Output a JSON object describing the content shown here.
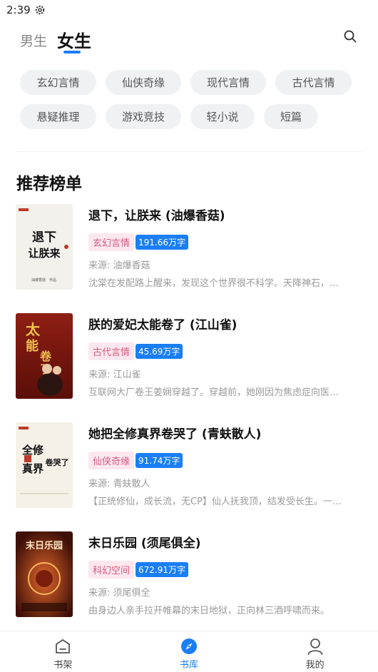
{
  "status": {
    "time": "2:39",
    "gear_icon": "gear-icon"
  },
  "header": {
    "tabs": [
      {
        "label": "男生",
        "active": false
      },
      {
        "label": "女生",
        "active": true
      }
    ],
    "search_icon": "search-icon"
  },
  "categories": [
    "玄幻言情",
    "仙侠奇缘",
    "现代言情",
    "古代言情",
    "悬疑推理",
    "游戏竞技",
    "轻小说",
    "短篇"
  ],
  "section": {
    "title": "推荐榜单"
  },
  "books": [
    {
      "title": "退下，让朕来 (油爆香菇)",
      "genre": "玄幻言情",
      "words": "191.66万字",
      "source": "来源: 油爆香菇",
      "intro": "沈棠在发配路上醒来，发现这个世界很不科学。天降神石，…",
      "cover_text": [
        "退下",
        "让朕来",
        "油爆香菇",
        "作品"
      ]
    },
    {
      "title": "朕的爱妃太能卷了 (江山雀)",
      "genre": "古代言情",
      "words": "45.69万字",
      "source": "来源: 江山雀",
      "intro": "互联网大厂卷王姜娴穿越了。穿越前，她刚因为焦虑症向医…",
      "cover_text": [
        "太",
        "能",
        "卷",
        "了"
      ]
    },
    {
      "title": "她把全修真界卷哭了 (青蚨散人)",
      "genre": "仙侠奇缘",
      "words": "91.74万字",
      "source": "来源: 青蚨散人",
      "intro": "【正统修仙，成长流，无CP】仙人抚我顶，结发受长生。一…",
      "cover_text": [
        "全修",
        "真界",
        "卷哭了"
      ]
    },
    {
      "title": "末日乐园 (须尾俱全)",
      "genre": "科幻空间",
      "words": "672.91万字",
      "source": "来源: 须尾俱全",
      "intro": "由身边人亲手拉开帷幕的末日地狱，正向林三酒呼啸而来。",
      "cover_text": [
        "末日乐园"
      ]
    }
  ],
  "bottom_nav": [
    {
      "label": "书架",
      "icon": "bookshelf-icon",
      "active": false
    },
    {
      "label": "书库",
      "icon": "compass-icon",
      "active": true
    },
    {
      "label": "我的",
      "icon": "profile-icon",
      "active": false
    }
  ],
  "colors": {
    "accent": "#1a7ef5",
    "tag_bg": "#fde7ee",
    "tag_text": "#d65b7d",
    "chip_bg": "#f0f1f3"
  }
}
